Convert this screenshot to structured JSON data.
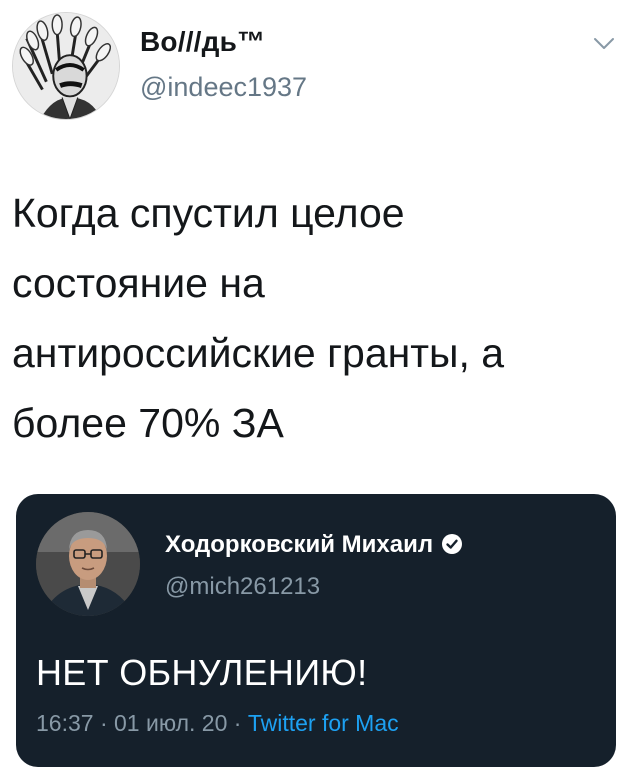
{
  "tweet": {
    "display_name": "Во///дь™",
    "handle": "@indeec1937",
    "text": "Когда спустил целое\nсостояние на\nантироссийские гранты, а\nболее 70% ЗА",
    "avatar_icon": "portrait-in-headdress",
    "menu_icon": "chevron-down-icon"
  },
  "quoted": {
    "display_name": "Ходорковский Михаил",
    "verified_icon": "verified-badge-icon",
    "handle": "@mich261213",
    "text": "НЕТ ОБНУЛЕНИЮ!",
    "time": "16:37",
    "date": "01 июл. 20",
    "separator": "·",
    "source": "Twitter for Mac",
    "background": "#15202b",
    "link_color": "#1da1f2"
  }
}
